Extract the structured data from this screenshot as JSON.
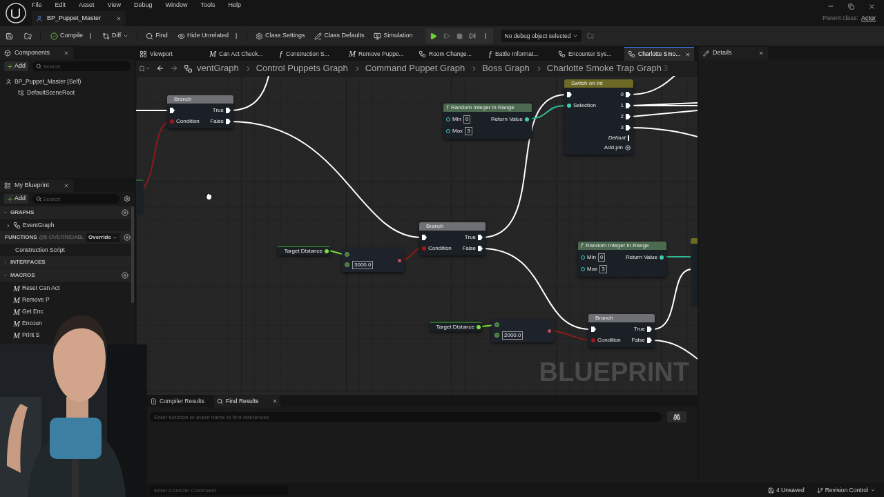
{
  "title_bar": {
    "menu": [
      "File",
      "Edit",
      "Asset",
      "View",
      "Debug",
      "Window",
      "Tools",
      "Help"
    ],
    "asset_tab": {
      "label": "BP_Puppet_Master"
    },
    "parent_class": {
      "label": "Parent class:",
      "value": "Actor"
    }
  },
  "toolbar": {
    "compile": "Compile",
    "diff": "Diff",
    "find": "Find",
    "hide_unrelated": "Hide Unrelated",
    "class_settings": "Class Settings",
    "class_defaults": "Class Defaults",
    "simulation": "Simulation",
    "debug_object": "No debug object selected"
  },
  "components": {
    "tab": "Components",
    "add": "Add",
    "search_placeholder": "Search",
    "tree": [
      {
        "label": "BP_Puppet_Master (Self)",
        "children": [
          {
            "label": "DefaultSceneRoot"
          }
        ]
      }
    ]
  },
  "my_blueprint": {
    "tab": "My Blueprint",
    "add": "Add",
    "search_placeholder": "Search",
    "sections": [
      {
        "title": "GRAPHS",
        "expanded": true,
        "addable": true,
        "items": [
          {
            "label": "EventGraph",
            "kind": "graph",
            "expanded": false
          }
        ]
      },
      {
        "title": "FUNCTIONS",
        "note": "(65 OVERRIDABL",
        "override": "Override",
        "expanded": true,
        "addable": true,
        "items": [
          {
            "label": "Construction Script",
            "kind": "function"
          }
        ]
      },
      {
        "title": "INTERFACES",
        "expanded": false,
        "addable": false
      },
      {
        "title": "MACROS",
        "expanded": true,
        "addable": true,
        "items": [
          {
            "label": "Reset Can Act",
            "kind": "macro",
            "glyph": "M"
          },
          {
            "label": "Remove P",
            "kind": "macro",
            "glyph": "M"
          },
          {
            "label": "Get Enc",
            "kind": "macro",
            "glyph": "M"
          },
          {
            "label": "Encoun",
            "kind": "macro",
            "glyph": "M"
          },
          {
            "label": "Print S",
            "kind": "macro",
            "glyph": "M"
          }
        ]
      }
    ]
  },
  "document_tabs": [
    {
      "label": "Viewport",
      "kind": "viewport",
      "selected": false
    },
    {
      "label": "Can Act Check...",
      "kind": "macro",
      "glyph": "M",
      "selected": false
    },
    {
      "label": "Construction S...",
      "kind": "function",
      "glyph": "ƒ",
      "selected": false
    },
    {
      "label": "Remove Puppe...",
      "kind": "macro",
      "glyph": "M",
      "selected": false
    },
    {
      "label": "Room Change...",
      "kind": "graph",
      "selected": false
    },
    {
      "label": "Battle Informat...",
      "kind": "function",
      "glyph": "ƒ",
      "selected": false
    },
    {
      "label": "Encounter Sys...",
      "kind": "graph",
      "selected": false
    },
    {
      "label": "Charlotte Smo...",
      "kind": "graph",
      "selected": true
    }
  ],
  "breadcrumb": {
    "crumbs": [
      "ventGraph",
      "Control Puppets Graph",
      "Command Puppet Graph",
      "Boss Graph",
      "Charlotte Smoke Trap Graph"
    ],
    "overflow": "3"
  },
  "graph": {
    "watermark": "BLUEPRINT",
    "nodes": [
      {
        "kind": "switch",
        "title": "Switch on Int",
        "input": "Selection",
        "outputs": [
          "0",
          "1",
          "2",
          "3"
        ],
        "default": "Default",
        "add_pin": "Add pin"
      },
      {
        "kind": "branch",
        "title": "Branch",
        "condition": "Condition",
        "outputs": [
          "True",
          "False"
        ]
      },
      {
        "kind": "random_int",
        "title": "Random Integer in Range",
        "glyph": "ƒ",
        "inputs": [
          {
            "label": "Min",
            "value": "0"
          },
          {
            "label": "Max",
            "value": "3"
          }
        ],
        "output": "Return Value"
      },
      {
        "kind": "branch",
        "title": "Branch",
        "condition": "Condition",
        "outputs": [
          "True",
          "False"
        ]
      },
      {
        "kind": "variable",
        "title": "Target Distance"
      },
      {
        "kind": "compare",
        "value": "3000.0"
      },
      {
        "kind": "random_int",
        "title": "Random Integer in Range",
        "glyph": "ƒ",
        "inputs": [
          {
            "label": "Min",
            "value": "0"
          },
          {
            "label": "Max",
            "value": "3"
          }
        ],
        "output": "Return Value"
      },
      {
        "kind": "variable",
        "title": "Target Distance"
      },
      {
        "kind": "compare",
        "value": "2000.0"
      },
      {
        "kind": "branch",
        "title": "Branch",
        "condition": "Condition",
        "outputs": [
          "True",
          "False"
        ]
      }
    ]
  },
  "details": {
    "tab": "Details"
  },
  "bottom_panel": {
    "tabs": [
      {
        "label": "Compiler Results",
        "selected": false
      },
      {
        "label": "Find Results",
        "selected": true
      }
    ],
    "search_placeholder": "Enter function or event name to find references"
  },
  "status_bar": {
    "console_placeholder": "Enter Console Command",
    "unsaved": "4 Unsaved",
    "revision_control": "Revision Control"
  }
}
